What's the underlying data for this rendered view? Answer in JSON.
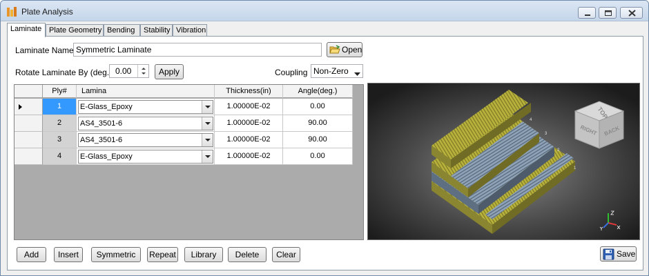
{
  "window": {
    "title": "Plate Analysis"
  },
  "tabs": [
    {
      "label": "Laminate",
      "active": true
    },
    {
      "label": "Plate Geometry"
    },
    {
      "label": "Bending"
    },
    {
      "label": "Stability"
    },
    {
      "label": "Vibration"
    }
  ],
  "form": {
    "laminate_name_label": "Laminate Name:",
    "laminate_name_value": "Symmetric Laminate",
    "open_label": "Open",
    "rotate_label": "Rotate Laminate By (deg.)",
    "rotate_value": "0.00",
    "apply_label": "Apply",
    "coupling_label": "Coupling",
    "coupling_value": "Non-Zero"
  },
  "grid": {
    "columns": [
      "Ply#",
      "Lamina",
      "Thickness(in)",
      "Angle(deg.)"
    ],
    "rows": [
      {
        "ply": "1",
        "lamina": "E-Glass_Epoxy",
        "thickness": "1.00000E-02",
        "angle": "0.00",
        "selected": true
      },
      {
        "ply": "2",
        "lamina": "AS4_3501-6",
        "thickness": "1.00000E-02",
        "angle": "90.00"
      },
      {
        "ply": "3",
        "lamina": "AS4_3501-6",
        "thickness": "1.00000E-02",
        "angle": "90.00"
      },
      {
        "ply": "4",
        "lamina": "E-Glass_Epoxy",
        "thickness": "1.00000E-02",
        "angle": "0.00"
      }
    ]
  },
  "viewer": {
    "cube_faces": {
      "top": "TOP",
      "right": "RIGHT",
      "back": "BACK"
    },
    "ply_labels": [
      "1",
      "2",
      "3",
      "4"
    ],
    "colors": {
      "glass": "#b8b23c",
      "carbon": "#8fa3b8"
    }
  },
  "buttons": {
    "add": "Add",
    "insert": "Insert",
    "symmetric": "Symmetric",
    "repeat": "Repeat",
    "library": "Library",
    "delete": "Delete",
    "clear": "Clear",
    "save": "Save"
  },
  "icons": {
    "app": "plate-analysis-app-icon",
    "open": "folder-open-icon",
    "save": "floppy-disk-icon",
    "minimize": "minimize-icon",
    "maximize": "maximize-icon",
    "close": "close-icon"
  }
}
